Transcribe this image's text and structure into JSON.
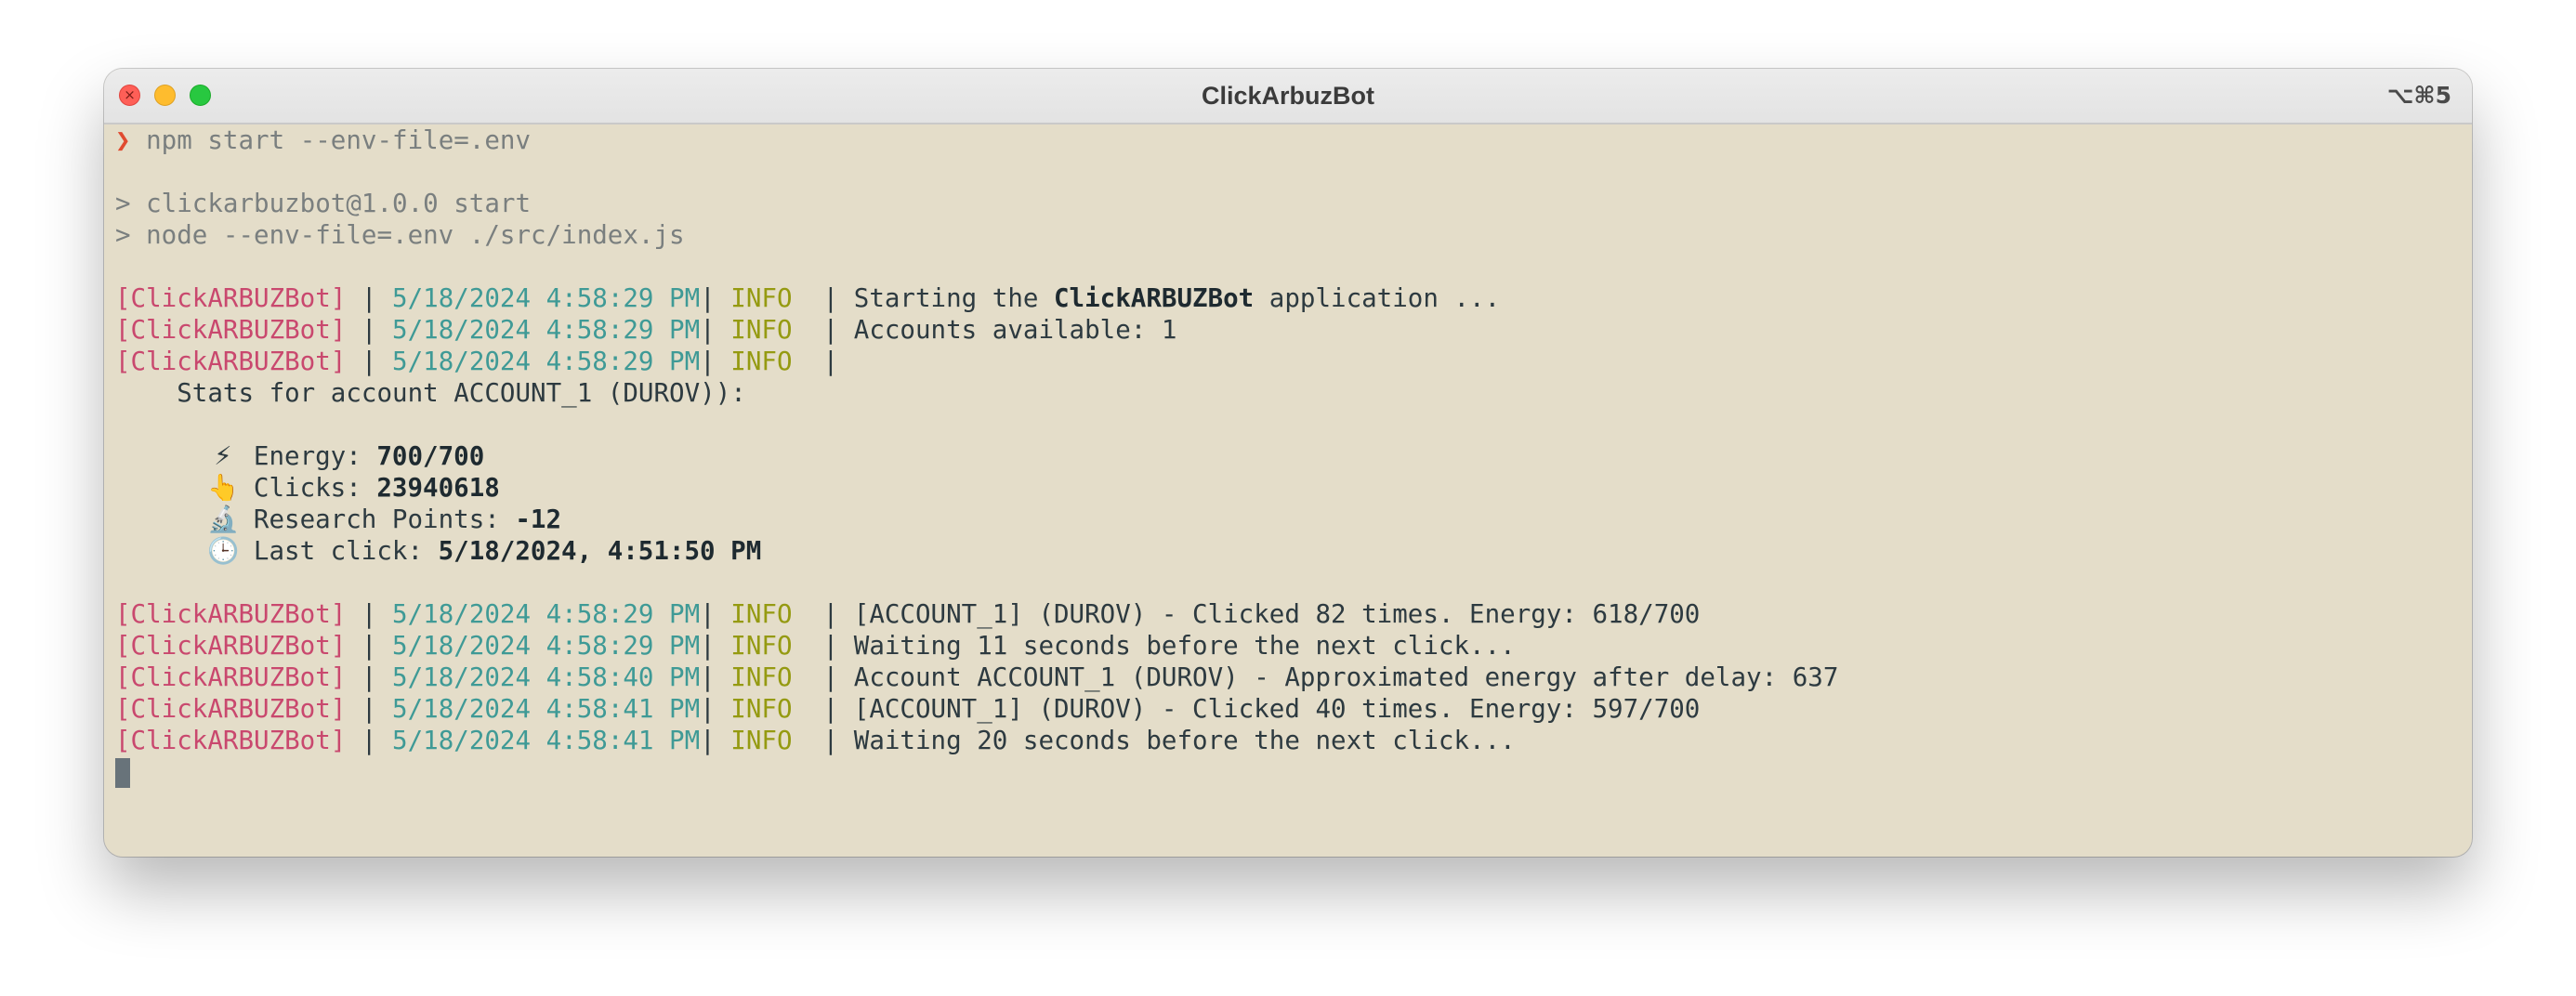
{
  "window": {
    "title": "ClickArbuzBot",
    "shortcut": "⌥⌘5",
    "close_glyph": "×"
  },
  "terminal": {
    "prompt_symbol": "❯",
    "command": "npm start --env-file=.env",
    "script_header": [
      "> clickarbuzbot@1.0.0 start",
      "> node --env-file=.env ./src/index.js"
    ],
    "log_prefix": {
      "tag": "[ClickARBUZBot]",
      "sep1": " | ",
      "sep2": "| ",
      "level": "INFO",
      "sep3": "  | "
    },
    "logs_top": [
      {
        "ts": "5/18/2024 4:58:29 PM",
        "pre": "Starting the ",
        "bold": "ClickARBUZBot",
        "post": " application ..."
      },
      {
        "ts": "5/18/2024 4:58:29 PM",
        "pre": "Accounts available: 1",
        "bold": "",
        "post": ""
      },
      {
        "ts": "5/18/2024 4:58:29 PM",
        "pre": "",
        "bold": "",
        "post": ""
      }
    ],
    "stats": {
      "title": "    Stats for account ACCOUNT_1 (DUROV)):",
      "rows": [
        {
          "icon": "lightning-icon",
          "emoji": "⚡",
          "label": " Energy: ",
          "value": "700/700"
        },
        {
          "icon": "pointing-hand-icon",
          "emoji": "👆",
          "label": " Clicks: ",
          "value": "23940618"
        },
        {
          "icon": "microscope-icon",
          "emoji": "🔬",
          "label": " Research Points: ",
          "value": "-12"
        },
        {
          "icon": "clock-icon",
          "emoji": "🕒",
          "label": " Last click: ",
          "value": "5/18/2024, 4:51:50 PM"
        }
      ]
    },
    "logs_bottom": [
      {
        "ts": "5/18/2024 4:58:29 PM",
        "msg": "[ACCOUNT_1] (DUROV) - Clicked 82 times. Energy: 618/700"
      },
      {
        "ts": "5/18/2024 4:58:29 PM",
        "msg": "Waiting 11 seconds before the next click..."
      },
      {
        "ts": "5/18/2024 4:58:40 PM",
        "msg": "Account ACCOUNT_1 (DUROV) - Approximated energy after delay: 637"
      },
      {
        "ts": "5/18/2024 4:58:41 PM",
        "msg": "[ACCOUNT_1] (DUROV) - Clicked 40 times. Energy: 597/700"
      },
      {
        "ts": "5/18/2024 4:58:41 PM",
        "msg": "Waiting 20 seconds before the next click..."
      }
    ]
  },
  "colors": {
    "terminal_bg": "#e4ddc9",
    "tag": "#c9486e",
    "timestamp": "#3f9a96",
    "level": "#959a11",
    "prompt": "#e04a2f"
  }
}
